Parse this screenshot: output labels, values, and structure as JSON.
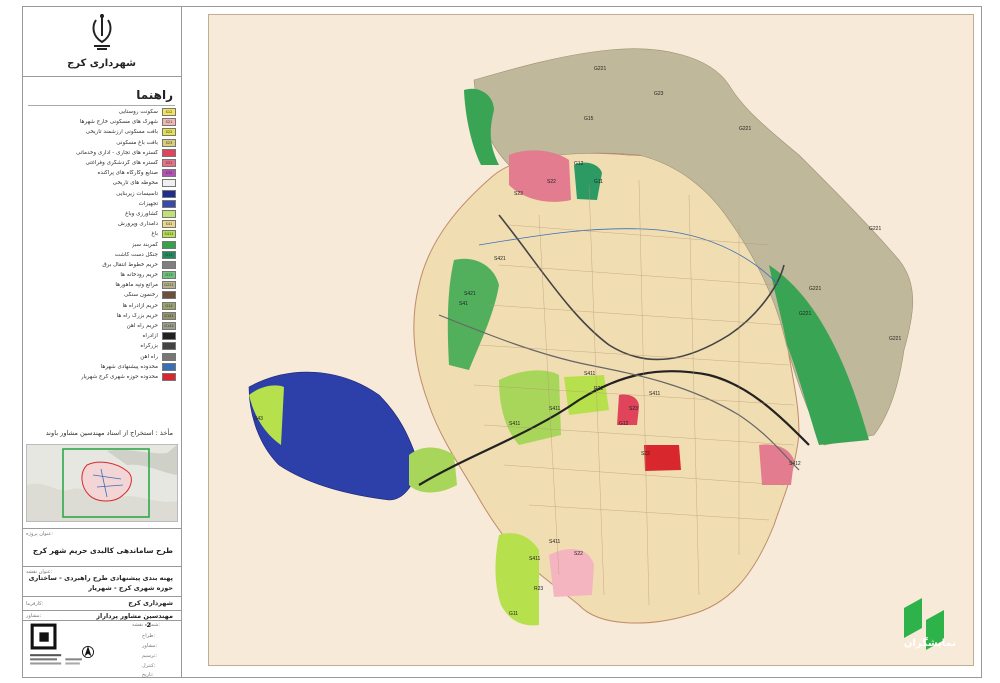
{
  "org_name": "شهرداری کرج",
  "legend_title": "راهنما",
  "legend": [
    {
      "code": "S12",
      "label": "سکونت روستایی",
      "color": "#f3e35e"
    },
    {
      "code": "S21",
      "label": "شهرک های مسکونی خارج شهرها",
      "color": "#f2b6b6"
    },
    {
      "code": "S22",
      "label": "بافت مسکونی ارزشمند تاریخی",
      "color": "#e4e04f"
    },
    {
      "code": "S23",
      "label": "بافت باغ مسکونی",
      "color": "#d8cf7a"
    },
    {
      "code": "",
      "label": "گستره های تجاری - اداری وخدماتی",
      "color": "#e0445a"
    },
    {
      "code": "S31",
      "label": "گستره های گردشگری وفراغتی",
      "color": "#e8718a"
    },
    {
      "code": "S32",
      "label": "صنایع وکارگاه های پراکنده",
      "color": "#b552b8"
    },
    {
      "code": "",
      "label": "محوطه های تاریخی",
      "color": "#f0f0f0"
    },
    {
      "code": "",
      "label": "تاسیسات زیربنایی",
      "color": "#1f2f8f"
    },
    {
      "code": "",
      "label": "تجهیزات",
      "color": "#3a4aa8"
    },
    {
      "code": "",
      "label": "کشاورزی وباغ",
      "color": "#c2e07a"
    },
    {
      "code": "S41",
      "label": "دامداری وپرورش",
      "color": "#ead88a"
    },
    {
      "code": "S411",
      "label": "باغ",
      "color": "#b6e14c"
    },
    {
      "code": "",
      "label": "کمربند سبز",
      "color": "#36a24a"
    },
    {
      "code": "G11",
      "label": "جنگل دست کاشت",
      "color": "#1f8a5b"
    },
    {
      "code": "",
      "label": "حریم خطوط انتقال برق",
      "color": "#7f7f7f"
    },
    {
      "code": "G13",
      "label": "حریم رودخانه ها",
      "color": "#6fc27b"
    },
    {
      "code": "G221",
      "label": "مراتع وتپه ماهورها",
      "color": "#b7b08f"
    },
    {
      "code": "",
      "label": "رخنمون سنگی",
      "color": "#6e4f3c"
    },
    {
      "code": "G14",
      "label": "حریم آزادراه ها",
      "color": "#9aa16d"
    },
    {
      "code": "G141",
      "label": "حریم بزرگ راه ها",
      "color": "#95956e"
    },
    {
      "code": "G142",
      "label": "حریم راه آهن",
      "color": "#9d9d8c"
    },
    {
      "code": "",
      "label": "آزادراه",
      "color": "#222222"
    },
    {
      "code": "",
      "label": "بزرگراه",
      "color": "#444444"
    },
    {
      "code": "",
      "label": "راه آهن",
      "color": "#777777"
    },
    {
      "code": "",
      "label": "محدوده پیشنهادی شهرها",
      "color": "#3a6fb8"
    },
    {
      "code": "",
      "label": "محدوده حوزه شهری کرج شهریار",
      "color": "#d8282e"
    }
  ],
  "source": "مأخذ : استخراج از اسناد مهندسین مشاور باوند",
  "title_block": {
    "project_caption": "عنوان پروژه:",
    "project_title": "طرح ساماندهی کالبدی حریم شهر کرج",
    "map_caption": "عنوان نقشه:",
    "map_title_1": "پهنه بندی پیشنهادی طرح راهبردی - ساختاری",
    "map_title_2": "حوزه شهری کرج - شهریار",
    "employer_caption": "کارفرما:",
    "employer": "شهرداری کرج",
    "consultant_caption": "مشاور:",
    "consultant": "مهندسین مشاور پرداراز",
    "sheet_caption": "شماره نقشه:",
    "sheet_number": "2",
    "roles": [
      "طراح:",
      "مشاور:",
      "ترسیم:",
      "کنترل:",
      "تاریخ:"
    ]
  },
  "watermark_text": "نمایشگران",
  "zone_labels": [
    "G221",
    "G23",
    "G15",
    "G12",
    "G11",
    "S22",
    "S23",
    "G221",
    "G221",
    "G221",
    "G221",
    "S421",
    "S411",
    "S411",
    "S411",
    "R21",
    "S22",
    "S23",
    "G12",
    "S411",
    "G221",
    "S43",
    "S41",
    "S412",
    "S411",
    "S421",
    "R23",
    "S22",
    "S411",
    "G11"
  ]
}
